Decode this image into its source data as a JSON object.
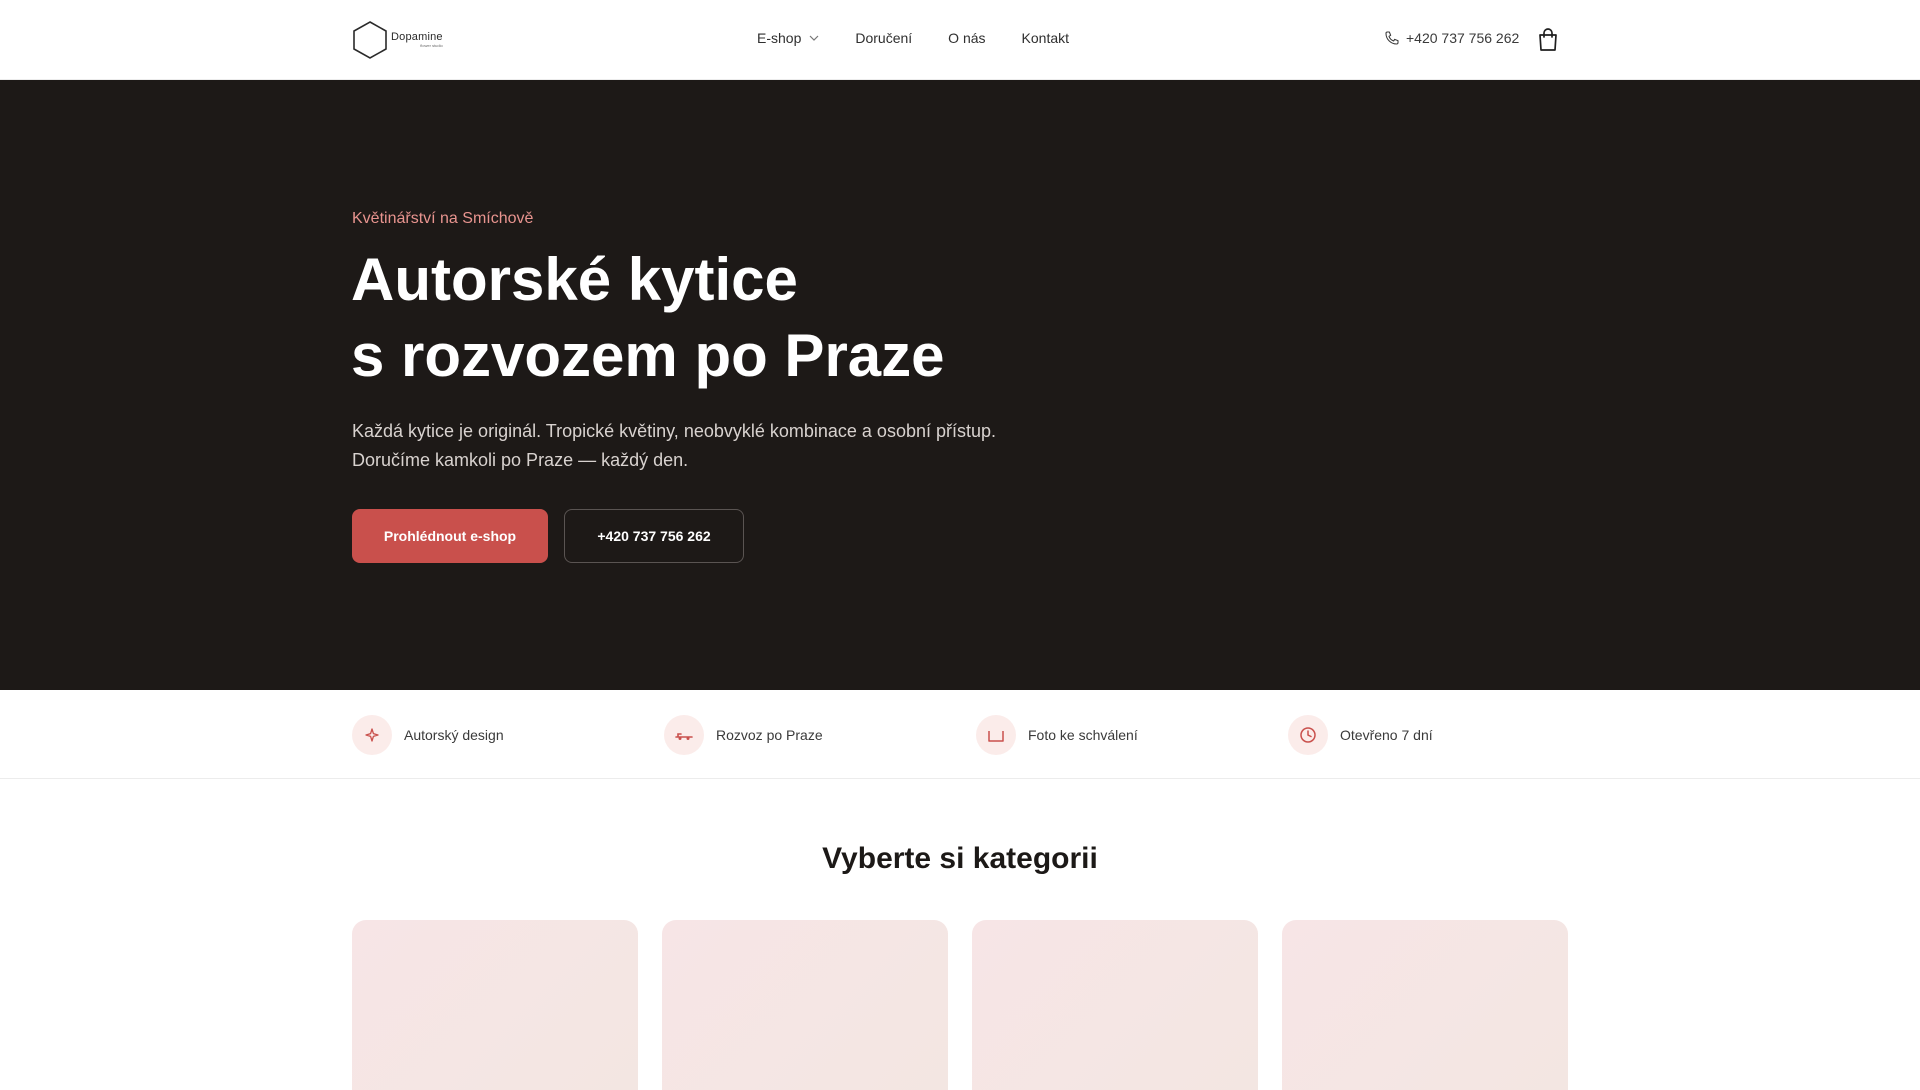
{
  "header": {
    "logo": {
      "name": "Dopamine",
      "sub": "flower studio"
    },
    "nav": [
      {
        "label": "E-shop",
        "has_dropdown": true
      },
      {
        "label": "Doručení"
      },
      {
        "label": "O nás"
      },
      {
        "label": "Kontakt"
      }
    ],
    "phone": "+420 737 756 262"
  },
  "hero": {
    "eyebrow": "Květinářství na Smíchově",
    "title_line1": "Autorské kytice",
    "title_line2": "s rozvozem po Praze",
    "text_line1": "Každá kytice je originál. Tropické květiny, neobvyklé kombinace a osobní přístup.",
    "text_line2": "Doručíme kamkoli po Praze — každý den.",
    "primary_button": "Prohlédnout e-shop",
    "secondary_button": "+420 737 756 262"
  },
  "features": [
    {
      "label": "Autorský design",
      "icon": "sparkle-icon"
    },
    {
      "label": "Rozvoz po Praze",
      "icon": "car-icon"
    },
    {
      "label": "Foto ke schválení",
      "icon": "camera-icon"
    },
    {
      "label": "Otevřeno 7 dní",
      "icon": "clock-icon"
    }
  ],
  "categories": {
    "title": "Vyberte si kategorii"
  },
  "colors": {
    "accent": "#c9504c",
    "hero_bg": "#1d1917",
    "eyebrow": "#e8948f",
    "icon_bg": "#fbecea"
  }
}
